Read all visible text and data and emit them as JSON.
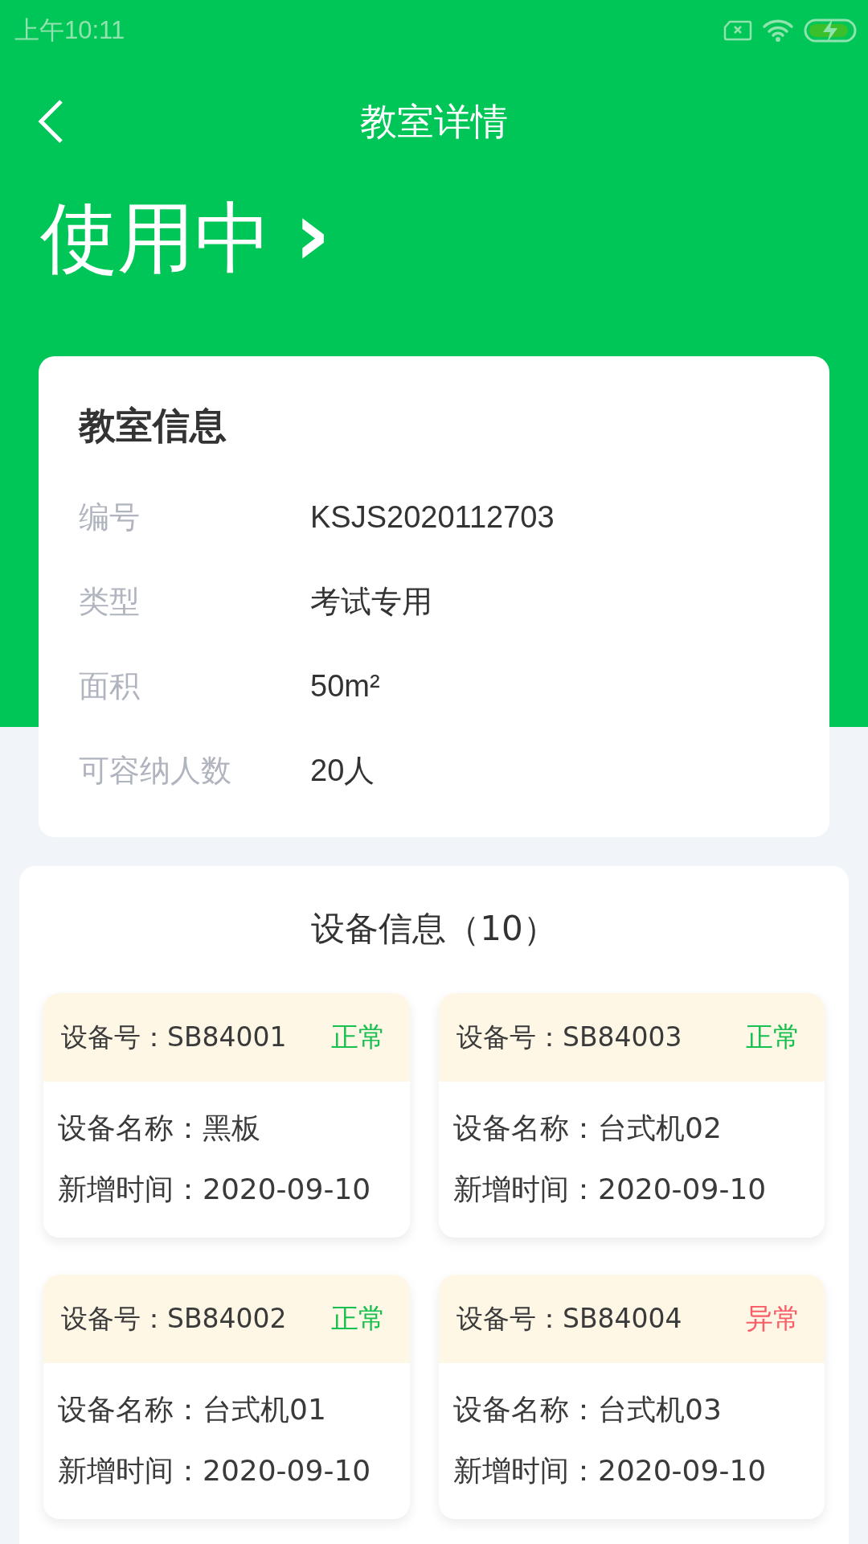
{
  "status_bar": {
    "time": "上午10:11"
  },
  "header": {
    "title": "教室详情"
  },
  "usage_status": {
    "label": "使用中",
    "chevron": "›"
  },
  "classroom_info": {
    "title": "教室信息",
    "rows": [
      {
        "label": "编号",
        "value": "KSJS2020112703"
      },
      {
        "label": "类型",
        "value": "考试专用"
      },
      {
        "label": "面积",
        "value": "50m²"
      },
      {
        "label": "可容纳人数",
        "value": "20人"
      }
    ]
  },
  "device_info": {
    "title": "设备信息（10）",
    "devices": [
      {
        "number": "设备号：SB84001",
        "status": "正常",
        "kind": "normal",
        "name": "设备名称：黑板",
        "added": "新增时间：2020-09-10"
      },
      {
        "number": "设备号：SB84003",
        "status": "正常",
        "kind": "normal",
        "name": "设备名称：台式机02",
        "added": "新增时间：2020-09-10"
      },
      {
        "number": "设备号：SB84002",
        "status": "正常",
        "kind": "normal",
        "name": "设备名称：台式机01",
        "added": "新增时间：2020-09-10"
      },
      {
        "number": "设备号：SB84004",
        "status": "异常",
        "kind": "abnormal",
        "name": "设备名称：台式机03",
        "added": "新增时间：2020-09-10"
      }
    ]
  }
}
